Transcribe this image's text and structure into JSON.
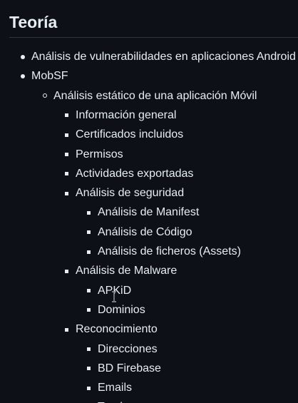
{
  "heading": "Teoría",
  "items": [
    {
      "label": "Análisis de vulnerabilidades en aplicaciones Android",
      "level": 1
    },
    {
      "label": "MobSF",
      "level": 1
    },
    {
      "label": "Análisis estático de una aplicación Móvil",
      "level": 2
    },
    {
      "label": "Información general",
      "level": 3
    },
    {
      "label": "Certificados incluidos",
      "level": 3
    },
    {
      "label": "Permisos",
      "level": 3
    },
    {
      "label": "Actividades exportadas",
      "level": 3
    },
    {
      "label": "Análisis de seguridad",
      "level": 3
    },
    {
      "label": "Análisis de Manifest",
      "level": 4
    },
    {
      "label": "Análisis de Código",
      "level": 4
    },
    {
      "label": "Análisis de ficheros (Assets)",
      "level": 4
    },
    {
      "label": "Análisis de Malware",
      "level": 3
    },
    {
      "label": "APKiD",
      "level": 4
    },
    {
      "label": "Dominios",
      "level": 4
    },
    {
      "label": "Reconocimiento",
      "level": 3
    },
    {
      "label": "Direcciones",
      "level": 4
    },
    {
      "label": "BD Firebase",
      "level": 4
    },
    {
      "label": "Emails",
      "level": 4
    },
    {
      "label": "Trackers",
      "level": 4
    }
  ],
  "colors": {
    "background": "#0d1117",
    "text": "#e6edf3",
    "divider": "#30363d"
  },
  "cursor_icon": "text-cursor-icon"
}
